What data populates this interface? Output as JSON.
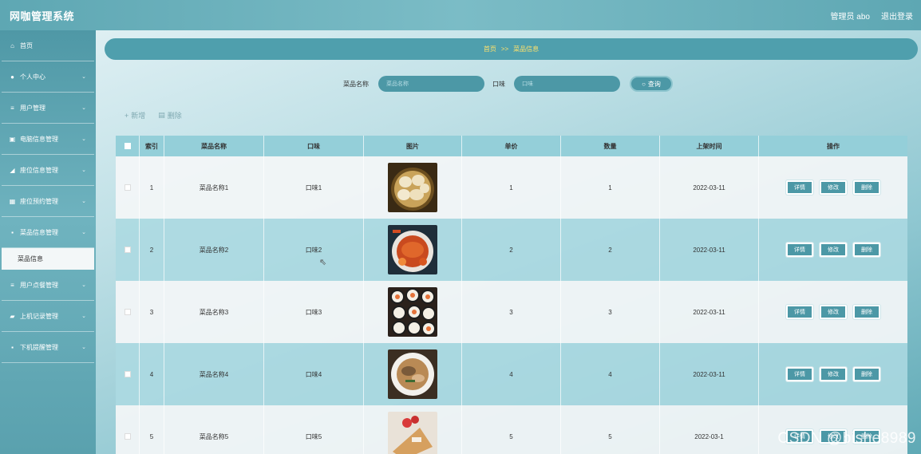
{
  "header": {
    "title": "网咖管理系统",
    "admin": "管理员 abo",
    "logout": "退出登录"
  },
  "sidebar": {
    "items": [
      {
        "label": "首页",
        "icon": "home-icon",
        "glyph": "⌂"
      },
      {
        "label": "个人中心",
        "icon": "user-icon",
        "glyph": "●"
      },
      {
        "label": "用户管理",
        "icon": "list-icon",
        "glyph": "≡"
      },
      {
        "label": "电脑信息管理",
        "icon": "computer-icon",
        "glyph": "▣"
      },
      {
        "label": "座位信息管理",
        "icon": "seat-icon",
        "glyph": "◢"
      },
      {
        "label": "座位预约管理",
        "icon": "grid-icon",
        "glyph": "▦"
      },
      {
        "label": "菜品信息管理",
        "icon": "apps-icon",
        "glyph": "▪"
      },
      {
        "label": "用户点餐管理",
        "icon": "list-icon",
        "glyph": "≡"
      },
      {
        "label": "上机记录管理",
        "icon": "record-icon",
        "glyph": "▰"
      },
      {
        "label": "下机提醒管理",
        "icon": "apps-icon",
        "glyph": "▪"
      }
    ],
    "sub_item": "菜品信息"
  },
  "breadcrumb": {
    "home": "首页",
    "sep": ">>",
    "current": "菜品信息"
  },
  "search": {
    "name_label": "菜品名称",
    "name_placeholder": "菜品名称",
    "taste_label": "口味",
    "taste_placeholder": "口味",
    "button": "查询"
  },
  "actions": {
    "add": "新增",
    "delete": "删除"
  },
  "table": {
    "headers": [
      "索引",
      "菜品名称",
      "口味",
      "图片",
      "单价",
      "数量",
      "上架时间",
      "操作"
    ],
    "rows": [
      {
        "index": "1",
        "name": "菜品名称1",
        "taste": "口味1",
        "price": "1",
        "qty": "1",
        "date": "2022-03-11",
        "image": "dumplings"
      },
      {
        "index": "2",
        "name": "菜品名称2",
        "taste": "口味2",
        "price": "2",
        "qty": "2",
        "date": "2022-03-11",
        "image": "crab"
      },
      {
        "index": "3",
        "name": "菜品名称3",
        "taste": "口味3",
        "price": "3",
        "qty": "3",
        "date": "2022-03-11",
        "image": "sushi"
      },
      {
        "index": "4",
        "name": "菜品名称4",
        "taste": "口味4",
        "price": "4",
        "qty": "4",
        "date": "2022-03-11",
        "image": "noodle-bowl"
      },
      {
        "index": "5",
        "name": "菜品名称5",
        "taste": "口味5",
        "price": "5",
        "qty": "5",
        "date": "2022-03-1",
        "image": "crepe"
      }
    ],
    "ops": {
      "detail": "详情",
      "edit": "修改",
      "delete": "删除"
    }
  },
  "watermark": "CSDN @bishe8989"
}
